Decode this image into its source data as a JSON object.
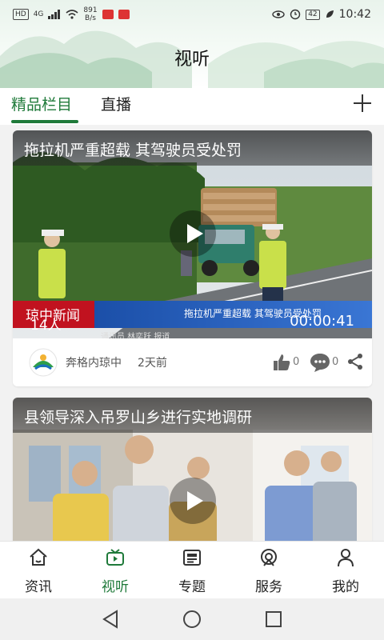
{
  "status_bar": {
    "network_label": "HD",
    "signal_label": "4G",
    "speed_value": "891",
    "speed_unit": "B/s",
    "battery": "42",
    "time": "10:42"
  },
  "page": {
    "title": "视听"
  },
  "tabs": [
    {
      "label": "精品栏目",
      "active": true
    },
    {
      "label": "直播",
      "active": false
    }
  ],
  "add_tab_icon": "plus-icon",
  "cards": [
    {
      "title": "拖拉机严重超载 其驾驶员受处罚",
      "news_label": "琼中新闻",
      "views": "14人",
      "lower_third": "拖拉机严重超载 其驾驶员受处罚",
      "credits": "通讯员 林奕跃 报道",
      "duration": "00:00:41",
      "source": "奔格内琼中",
      "time_ago": "2天前",
      "likes": "0",
      "comments": "0"
    },
    {
      "title": "县领导深入吊罗山乡进行实地调研"
    }
  ],
  "bottom_nav": [
    {
      "label": "资讯",
      "icon": "home-icon",
      "active": false
    },
    {
      "label": "视听",
      "icon": "tv-icon",
      "active": true
    },
    {
      "label": "专题",
      "icon": "newspaper-icon",
      "active": false
    },
    {
      "label": "服务",
      "icon": "service-icon",
      "active": false
    },
    {
      "label": "我的",
      "icon": "user-icon",
      "active": false
    }
  ],
  "colors": {
    "accent": "#1f7a3a",
    "news_red": "#c1121f",
    "news_blue": "#1b4fa8"
  }
}
